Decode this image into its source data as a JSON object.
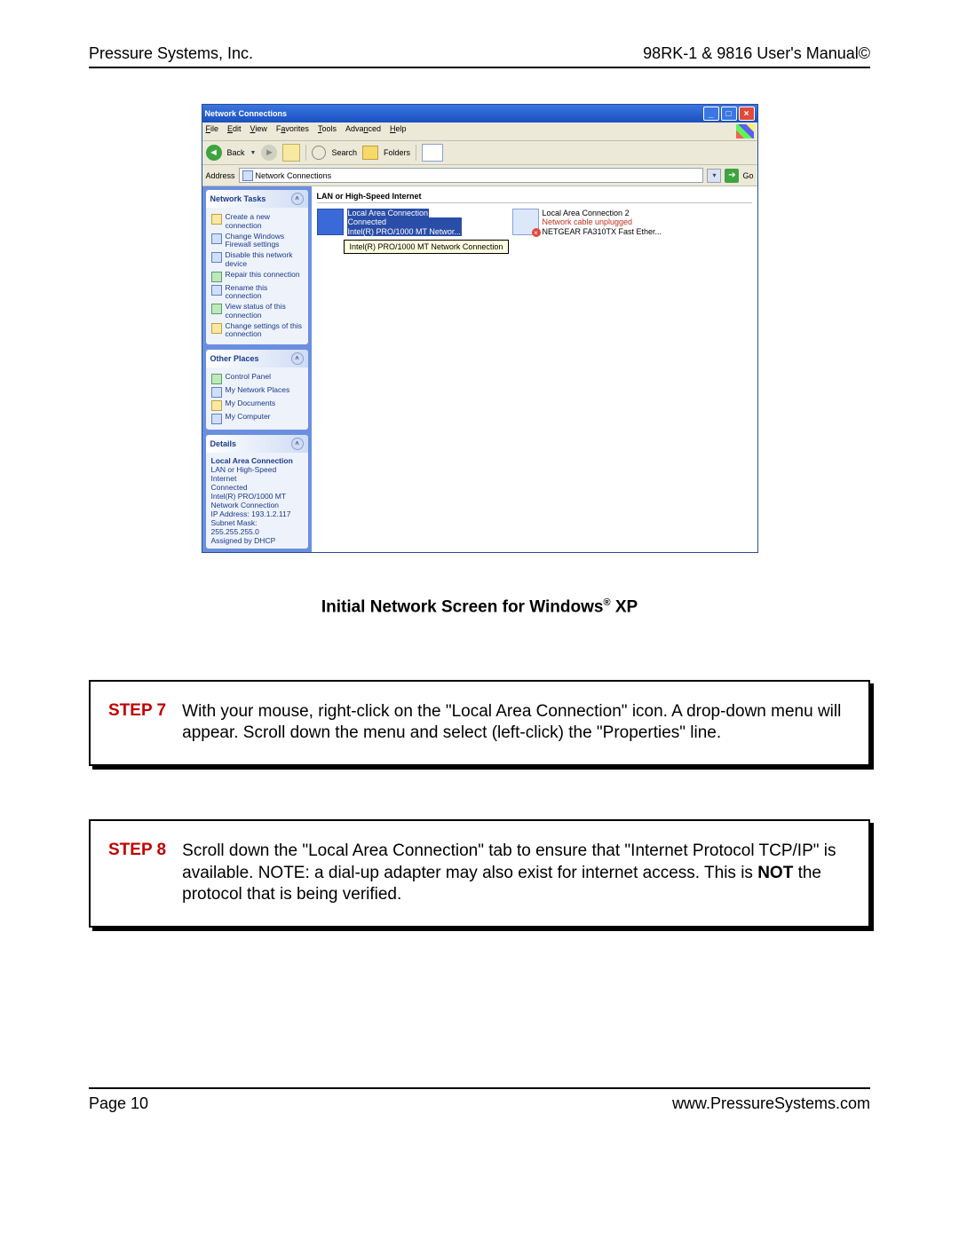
{
  "header": {
    "left": "Pressure Systems, Inc.",
    "right": "98RK-1 & 9816 User's Manual©"
  },
  "window": {
    "title": "Network Connections",
    "menus": [
      "File",
      "Edit",
      "View",
      "Favorites",
      "Tools",
      "Advanced",
      "Help"
    ],
    "toolbar": {
      "back": "Back",
      "search": "Search",
      "folders": "Folders"
    },
    "address": {
      "label": "Address",
      "value": "Network Connections",
      "go": "Go"
    },
    "sidebar": {
      "tasks": {
        "title": "Network Tasks",
        "items": [
          "Create a new connection",
          "Change Windows Firewall settings",
          "Disable this network device",
          "Repair this connection",
          "Rename this connection",
          "View status of this connection",
          "Change settings of this connection"
        ]
      },
      "other": {
        "title": "Other Places",
        "items": [
          "Control Panel",
          "My Network Places",
          "My Documents",
          "My Computer"
        ]
      },
      "details": {
        "title": "Details",
        "heading": "Local Area Connection",
        "lines": [
          "LAN or High-Speed Internet",
          "Connected",
          "Intel(R) PRO/1000 MT Network Connection",
          "IP Address: 193.1.2.117",
          "Subnet Mask: 255.255.255.0",
          "Assigned by DHCP"
        ]
      }
    },
    "content": {
      "category": "LAN or High-Speed Internet",
      "conn1": {
        "name": "Local Area Connection",
        "status": "Connected",
        "adapter": "Intel(R) PRO/1000 MT Networ..."
      },
      "conn2": {
        "name": "Local Area Connection 2",
        "status": "Network cable unplugged",
        "adapter": "NETGEAR FA310TX Fast Ether..."
      },
      "tooltip": "Intel(R) PRO/1000 MT Network Connection"
    }
  },
  "caption_pre": "Initial Network Screen for Windows",
  "caption_post": " XP",
  "step7": {
    "label": "STEP 7",
    "text": "With your mouse, right-click on the \"Local Area Connection\" icon.  A drop-down menu will appear.  Scroll down the menu and select (left-click) the \"Properties\" line."
  },
  "step8": {
    "label": "STEP 8",
    "t1": "Scroll down the \"Local Area Connection\" tab to ensure that \"Internet Protocol TCP/IP\" is available. NOTE: a dial-up adapter may also exist for internet access. This is ",
    "t2": "NOT",
    "t3": " the protocol that is being verified."
  },
  "footer": {
    "left": "Page 10",
    "right": "www.PressureSystems.com"
  }
}
